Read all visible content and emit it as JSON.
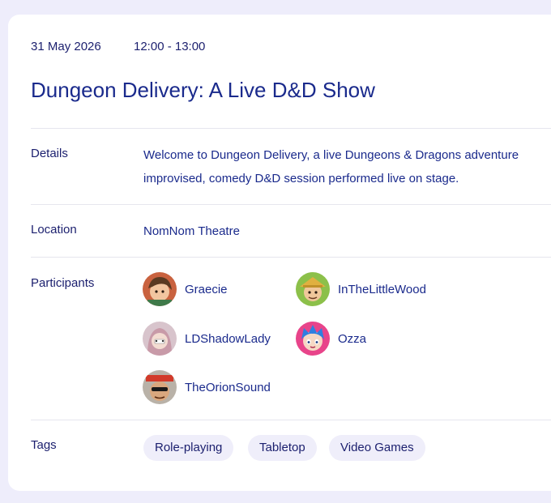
{
  "event": {
    "date": "31 May 2026",
    "time": "12:00 - 13:00",
    "title": "Dungeon Delivery: A Live D&D Show"
  },
  "details": {
    "label": "Details",
    "line1": "Welcome to Dungeon Delivery, a live Dungeons & Dragons adventure",
    "line2": "improvised, comedy D&D session performed live on stage."
  },
  "location": {
    "label": "Location",
    "value": "NomNom Theatre"
  },
  "participants": {
    "label": "Participants",
    "items": [
      {
        "name": "Graecie"
      },
      {
        "name": "InTheLittleWood"
      },
      {
        "name": "LDShadowLady"
      },
      {
        "name": "Ozza"
      },
      {
        "name": "TheOrionSound"
      }
    ]
  },
  "tags": {
    "label": "Tags",
    "items": [
      "Role-playing",
      "Tabletop",
      "Video Games"
    ]
  },
  "colors": {
    "background": "#eeedfb",
    "card": "#ffffff",
    "text": "#1b1f6e",
    "tag_bg": "#efeefa"
  }
}
